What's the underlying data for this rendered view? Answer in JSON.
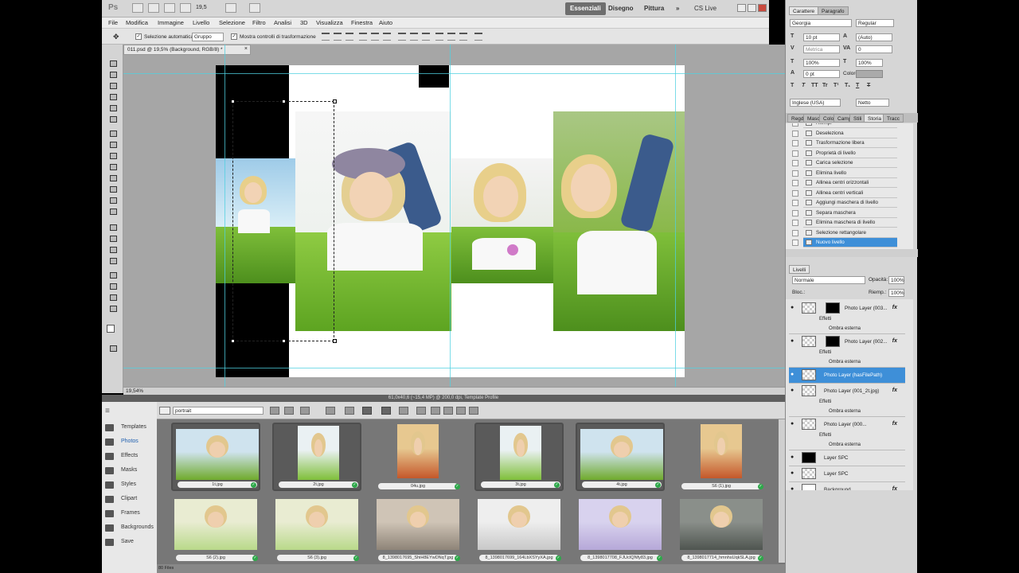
{
  "app": {
    "logo": "Ps",
    "zoom_combo": "19,5",
    "workspaces": [
      "Essenziali",
      "Disegno",
      "Pittura"
    ],
    "workspace_more": "»",
    "cslive": "CS Live"
  },
  "menu": [
    "File",
    "Modifica",
    "Immagine",
    "Livello",
    "Selezione",
    "Filtro",
    "Analisi",
    "3D",
    "Visualizza",
    "Finestra",
    "Aiuto"
  ],
  "options": {
    "auto_select_label": "Selezione automatica:",
    "auto_select_value": "Gruppo",
    "show_transform_label": "Mostra controlli di trasformazione"
  },
  "document": {
    "tab_title": "011.psd @ 19,5% (Background, RGB/8) *",
    "status_zoom": "19,54%"
  },
  "character_panel": {
    "tabs": [
      "Carattere",
      "Paragrafo"
    ],
    "font_family": "Georgia",
    "font_style": "Regular",
    "size": "10 pt",
    "leading": "(Auto)",
    "kerning": "Metrica",
    "tracking": "0",
    "vscale": "100%",
    "hscale": "100%",
    "baseline": "0 pt",
    "color_label": "Colore:",
    "language": "Inglese (USA)",
    "antialias": "Netto",
    "style_buttons": [
      "T",
      "T",
      "TT",
      "Tr",
      "T¹",
      "T₁",
      "T",
      "T"
    ]
  },
  "history_panel": {
    "tabs": [
      "Regd",
      "Masc",
      "Colo",
      "Camp",
      "Stili",
      "Storia",
      "Tracc"
    ],
    "items": [
      "Riempi",
      "Deseleziona",
      "Trasformazione libera",
      "Proprietà di livello",
      "Carica selezione",
      "Elimina livello",
      "Allinea centri orizzontali",
      "Allinea centri verticali",
      "Aggiungi maschera di livello",
      "Separa maschera",
      "Elimina maschera di livello",
      "Selezione rettangolare",
      "Nuovo livello"
    ],
    "selected_index": 12
  },
  "layers_panel": {
    "tab": "Livelli",
    "blend_mode": "Normale",
    "opacity_label": "Opacità:",
    "opacity": "100%",
    "lock_label": "Bloc.:",
    "fill_label": "Riemp.:",
    "fill": "100%",
    "effects_label": "Effetti",
    "shadow_label": "Ombra esterna",
    "fx_label": "fx",
    "eye_glyph": "●",
    "layers": [
      {
        "name": "Photo Layer  (003...",
        "mask": true,
        "effects": true
      },
      {
        "name": "Photo Layer  (002...",
        "mask": true,
        "effects": true
      },
      {
        "name": "Photo Layer  (hasFilePath)",
        "selected": true
      },
      {
        "name": "Photo Layer  (001_2t.jpg)",
        "effects": true
      },
      {
        "name": "Photo Layer  (000...",
        "effects": true
      },
      {
        "name": "Layer SPC"
      },
      {
        "name": "Layer SPC"
      },
      {
        "name": "Background"
      }
    ]
  },
  "browser": {
    "header": "61,0x40,6 (~15,4 MP) @ 200,0 dpi,  Template Profile",
    "category": "portrait",
    "sidebar": [
      "Templates",
      "Photos",
      "Effects",
      "Masks",
      "Styles",
      "Clipart",
      "Frames",
      "Backgrounds",
      "Save"
    ],
    "sidebar_active": 1,
    "check_glyph": "✓",
    "files": [
      {
        "name": "1t.jpg",
        "selected": true,
        "palette": "grass"
      },
      {
        "name": "2t.jpg",
        "selected": true,
        "palette": "portrait"
      },
      {
        "name": "04u.jpg",
        "selected": false,
        "palette": "flowers"
      },
      {
        "name": "3t.jpg",
        "selected": true,
        "palette": "portrait"
      },
      {
        "name": "4t.jpg",
        "selected": true,
        "palette": "grass"
      },
      {
        "name": "S6 (1).jpg",
        "selected": false,
        "palette": "flowers"
      },
      {
        "name": "S6 (2).jpg",
        "selected": false,
        "palette": "meadow"
      },
      {
        "name": "S6 (3).jpg",
        "selected": false,
        "palette": "meadow"
      },
      {
        "name": "8_1398017695_ShiH8EYwDNqT.jpg",
        "selected": false,
        "palette": "sepia"
      },
      {
        "name": "8_1398017699_164LbXSYyXA.jpg",
        "selected": false,
        "palette": "light"
      },
      {
        "name": "8_1398017708_FJUcIQNfy83.jpg",
        "selected": false,
        "palette": "lavender"
      },
      {
        "name": "8_1398017714_hmnhsUqkSLA.jpg",
        "selected": false,
        "palette": "dark"
      }
    ],
    "status": "80 Files"
  }
}
